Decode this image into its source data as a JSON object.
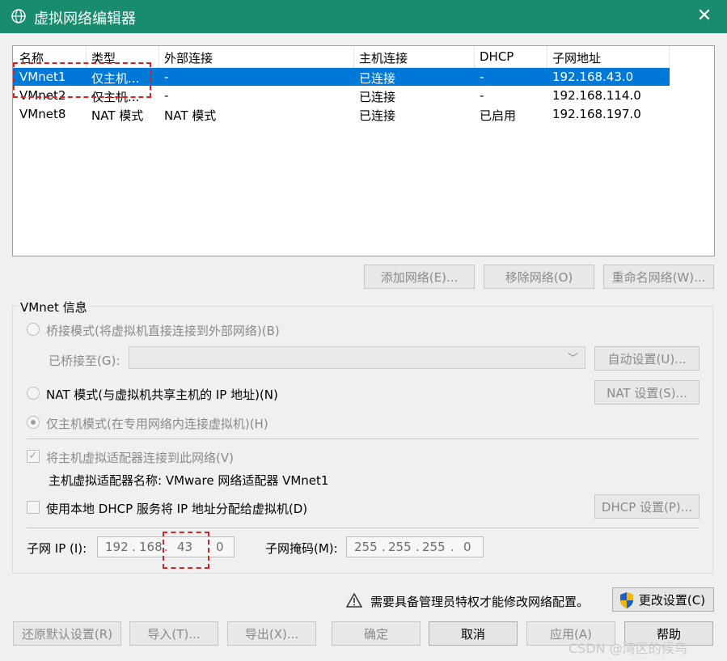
{
  "window": {
    "title": "虚拟网络编辑器",
    "close": "✕"
  },
  "table": {
    "columns": [
      "名称",
      "类型",
      "外部连接",
      "主机连接",
      "DHCP",
      "子网地址"
    ],
    "rows": [
      {
        "name": "VMnet1",
        "type": "仅主机...",
        "external": "-",
        "host": "已连接",
        "dhcp": "-",
        "subnet": "192.168.43.0",
        "selected": true
      },
      {
        "name": "VMnet2",
        "type": "仅主机...",
        "external": "-",
        "host": "已连接",
        "dhcp": "-",
        "subnet": "192.168.114.0",
        "selected": false
      },
      {
        "name": "VMnet8",
        "type": "NAT 模式",
        "external": "NAT 模式",
        "host": "已连接",
        "dhcp": "已启用",
        "subnet": "192.168.197.0",
        "selected": false
      }
    ]
  },
  "network_buttons": {
    "add": "添加网络(E)...",
    "remove": "移除网络(O)",
    "rename": "重命名网络(W)..."
  },
  "info": {
    "group_label": "VMnet 信息",
    "bridge_radio": "桥接模式(将虚拟机直接连接到外部网络)(B)",
    "bridged_to_label": "已桥接至(G):",
    "auto_button": "自动设置(U)...",
    "nat_radio": "NAT 模式(与虚拟机共享主机的 IP 地址)(N)",
    "nat_button": "NAT 设置(S)...",
    "hostonly_radio": "仅主机模式(在专用网络内连接虚拟机)(H)",
    "connect_adapter_check": "将主机虚拟适配器连接到此网络(V)",
    "adapter_name_text": "主机虚拟适配器名称: VMware 网络适配器 VMnet1",
    "dhcp_check": "使用本地 DHCP 服务将 IP 地址分配给虚拟机(D)",
    "dhcp_button": "DHCP 设置(P)...",
    "subnet_ip_label": "子网 IP (I):",
    "subnet_ip": [
      "192",
      "168",
      "43",
      "0"
    ],
    "subnet_mask_label": "子网掩码(M):",
    "subnet_mask": [
      "255",
      "255",
      "255",
      "0"
    ],
    "dot": "."
  },
  "admin": {
    "warning": "需要具备管理员特权才能修改网络配置。",
    "change_button": "更改设置(C)"
  },
  "footer": {
    "restore": "还原默认设置(R)",
    "import": "导入(T)...",
    "export": "导出(X)...",
    "ok": "确定",
    "cancel": "取消",
    "apply": "应用(A)",
    "help": "帮助"
  },
  "watermark": "CSDN @湾区的候鸟"
}
